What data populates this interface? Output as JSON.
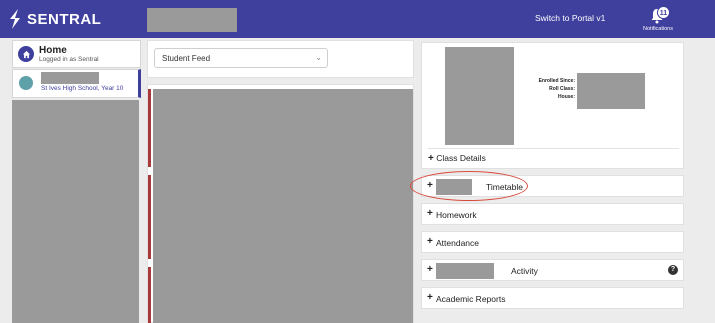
{
  "header": {
    "brand": "SENTRAL",
    "switch_portal": "Switch to Portal v1",
    "notifications_count": "11",
    "notifications_label": "Notifications",
    "bar_color": "#3f3f9e"
  },
  "sidebar": {
    "home_title": "Home",
    "home_subtitle": "Logged in as Sentral",
    "student_school": "St Ives High School, Year 10"
  },
  "feed": {
    "selected_option": "Student Feed"
  },
  "profile": {
    "enrolled_since_label": "Enrolled Since:",
    "roll_class_label": "Roll Class:",
    "house_label": "House:"
  },
  "sections": {
    "class_details": "Class Details",
    "timetable": "Timetable",
    "homework": "Homework",
    "attendance": "Attendance",
    "activity": "Activity",
    "academic_reports": "Academic Reports",
    "plus": "+"
  },
  "icons": {
    "logo": "sentral-s-icon",
    "notifications": "bell-icon",
    "home": "home-icon",
    "select": "chevron-down-icon",
    "help": "question-circle-icon"
  }
}
